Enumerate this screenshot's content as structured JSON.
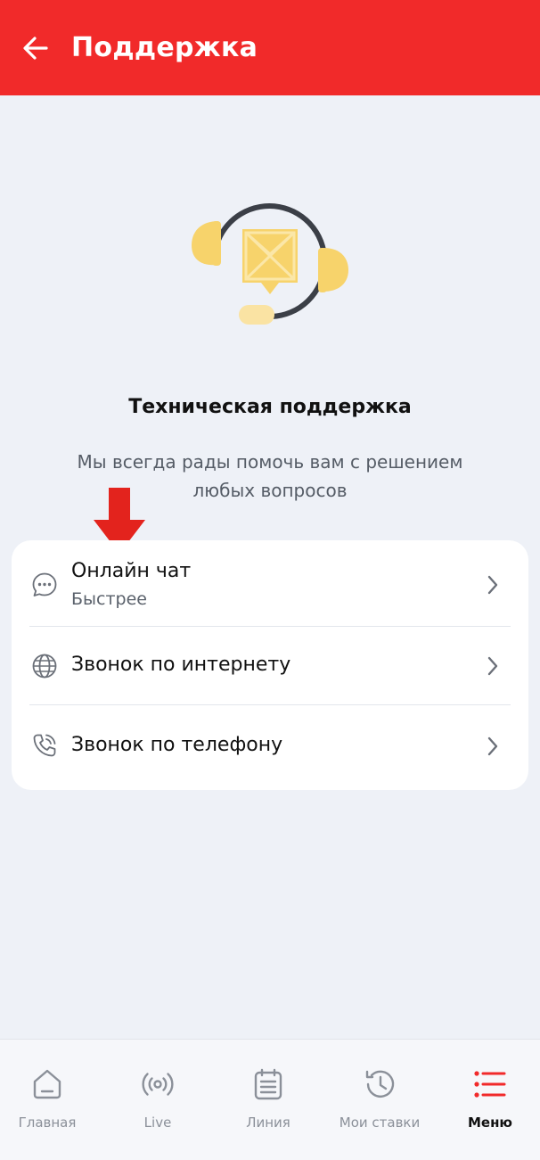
{
  "header": {
    "title": "Поддержка",
    "back_icon": "arrow-left-icon",
    "background": "#f12a2a"
  },
  "hero": {
    "illustration": "support-headset-illustration",
    "title": "Техническая поддержка",
    "subtitle_line1": "Мы всегда рады помочь вам с решением",
    "subtitle_line2": "любых вопросов"
  },
  "options": [
    {
      "label": "Онлайн чат",
      "sublabel": "Быстрее",
      "icon": "chat-bubble-icon"
    },
    {
      "label": "Звонок по интернету",
      "icon": "globe-icon"
    },
    {
      "label": "Звонок по телефону",
      "icon": "phone-call-icon"
    }
  ],
  "bottom_nav": {
    "items": [
      {
        "label": "Главная",
        "icon": "home-icon"
      },
      {
        "label": "Live",
        "icon": "broadcast-icon"
      },
      {
        "label": "Линия",
        "icon": "calendar-list-icon"
      },
      {
        "label": "Мои ставки",
        "icon": "history-clock-icon"
      },
      {
        "label": "Меню",
        "icon": "menu-list-icon",
        "active": true
      }
    ]
  },
  "colors": {
    "accent": "#f12a2a",
    "background": "#eef1f7",
    "illustration_yellow": "#f7d36b"
  }
}
